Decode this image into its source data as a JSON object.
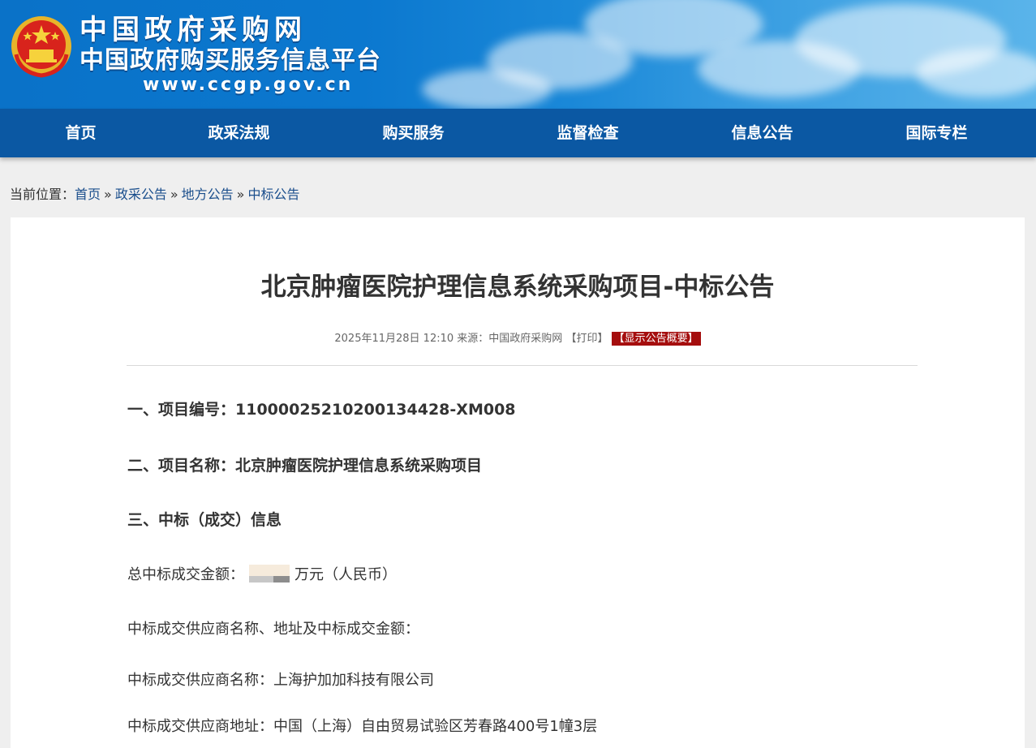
{
  "header": {
    "title_main": "中国政府采购网",
    "title_sub": "中国政府购买服务信息平台",
    "url": "www.ccgp.gov.cn",
    "emblem_icon": "national-emblem-icon"
  },
  "nav": {
    "items": [
      {
        "label": "首页"
      },
      {
        "label": "政采法规"
      },
      {
        "label": "购买服务"
      },
      {
        "label": "监督检查"
      },
      {
        "label": "信息公告"
      },
      {
        "label": "国际专栏"
      }
    ]
  },
  "breadcrumb": {
    "prefix": "当前位置：",
    "items": [
      "首页",
      "政采公告",
      "地方公告",
      "中标公告"
    ],
    "separator": "»"
  },
  "article": {
    "title": "北京肿瘤医院护理信息系统采购项目-中标公告",
    "date": "2025年11月28日 12:10",
    "source_label": "来源：",
    "source": "中国政府采购网",
    "print_label": "【打印】",
    "summary_label": "【显示公告概要】",
    "sections": {
      "s1": "一、项目编号：11000025210200134428-XM008",
      "s2": "二、项目名称：北京肿瘤医院护理信息系统采购项目",
      "s3": "三、中标（成交）信息"
    },
    "amount_label": "总中标成交金额：",
    "amount_unit": "万元（人民币）",
    "supplier_header": "中标成交供应商名称、地址及中标成交金额：",
    "supplier_name_line": "中标成交供应商名称：上海护加加科技有限公司",
    "supplier_addr_line": "中标成交供应商地址：中国（上海）自由贸易试验区芳春路400号1幢3层"
  },
  "colors": {
    "nav_bg": "#0b58a3",
    "banner_blue": "#0b78cf",
    "summary_badge": "#a50e0e",
    "page_bg": "#efefef"
  }
}
